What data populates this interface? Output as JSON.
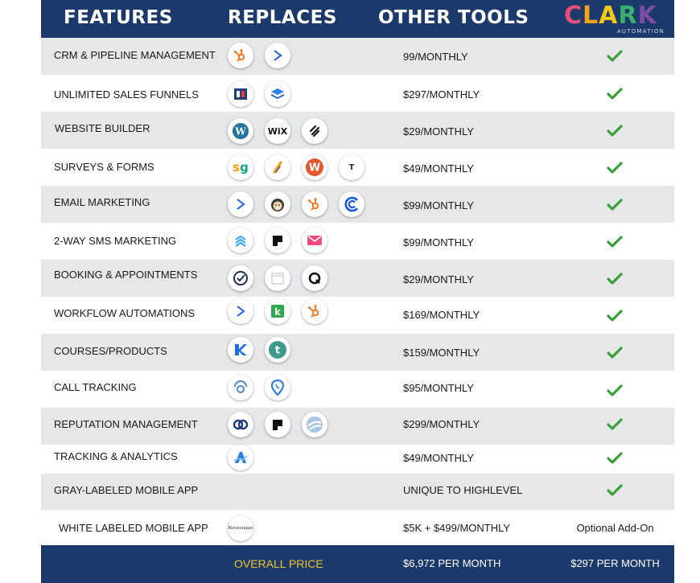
{
  "header": {
    "col_features": "FEATURES",
    "col_replaces": "REPLACES",
    "col_other_tools": "OTHER TOOLS",
    "logo_text": "CLARK",
    "logo_subtext": "AUTOMATION"
  },
  "colors": {
    "header_bg": "#1b3a6b",
    "row_grey": "#e6e7e8",
    "check_green": "#3aa03a",
    "footer_label": "#f1c232"
  },
  "rows": [
    {
      "feature": "CRM & PIPELINE MANAGEMENT",
      "price": "99/MONTHLY",
      "clark": "check",
      "icons": [
        "hubspot-icon",
        "activecampaign-icon"
      ]
    },
    {
      "feature": "UNLIMITED SALES FUNNELS",
      "price": "$297/MONTHLY",
      "clark": "check",
      "icons": [
        "clickfunnels-icon",
        "leadpages-icon"
      ]
    },
    {
      "feature": "WEBSITE BUILDER",
      "price": "$29/MONTHLY",
      "clark": "check",
      "icons": [
        "wordpress-icon",
        "wix-icon",
        "squarespace-icon"
      ]
    },
    {
      "feature": "SURVEYS & FORMS",
      "price": "$49/MONTHLY",
      "clark": "check",
      "icons": [
        "surveygizmo-icon",
        "jotform-icon",
        "wufoo-icon",
        "typeform-icon"
      ]
    },
    {
      "feature": "EMAIL MARKETING",
      "price": "$99/MONTHLY",
      "clark": "check",
      "icons": [
        "activecampaign-icon",
        "mailchimp-icon",
        "hubspot-icon",
        "constantcontact-icon"
      ]
    },
    {
      "feature": "2-WAY SMS MARKETING",
      "price": "$99/MONTHLY",
      "clark": "check",
      "icons": [
        "sms-stack-icon",
        "podium-icon",
        "mail-icon"
      ]
    },
    {
      "feature": "BOOKING & APPOINTMENTS",
      "price": "$29/MONTHLY",
      "clark": "check",
      "icons": [
        "calendly-icon",
        "acuity-icon",
        "q-icon"
      ]
    },
    {
      "feature": "WORKFLOW AUTOMATIONS",
      "price": "$169/MONTHLY",
      "clark": "check",
      "icons": [
        "activecampaign-icon",
        "keap-icon",
        "hubspot-icon"
      ]
    },
    {
      "feature": "COURSES/PRODUCTS",
      "price": "$159/MONTHLY",
      "clark": "check",
      "icons": [
        "kajabi-icon",
        "teachable-icon"
      ]
    },
    {
      "feature": "CALL TRACKING",
      "price": "$95/MONTHLY",
      "clark": "check",
      "icons": [
        "callrail-icon",
        "location-pin-icon"
      ]
    },
    {
      "feature": "REPUTATION MANAGEMENT",
      "price": "$299/MONTHLY",
      "clark": "check",
      "icons": [
        "birdeye-icon",
        "podium-icon",
        "reputation-icon"
      ]
    },
    {
      "feature": "TRACKING & ANALYTICS",
      "price": "$49/MONTHLY",
      "clark": "check",
      "icons": [
        "analytics-icon"
      ]
    },
    {
      "feature": "GRAY-LABELED MOBILE APP",
      "price": "UNIQUE TO HIGHLEVEL",
      "clark": "check",
      "icons": []
    },
    {
      "feature": "WHITE LABELED MOBILE APP",
      "price": "$5K + $499/MONTHLY",
      "clark": "Optional Add-On",
      "icons": [
        "bizness-apps-icon"
      ]
    }
  ],
  "footer": {
    "label": "OVERALL PRICE",
    "other_price": "$6,972 PER MONTH",
    "clark_price": "$297 PER MONTH"
  }
}
